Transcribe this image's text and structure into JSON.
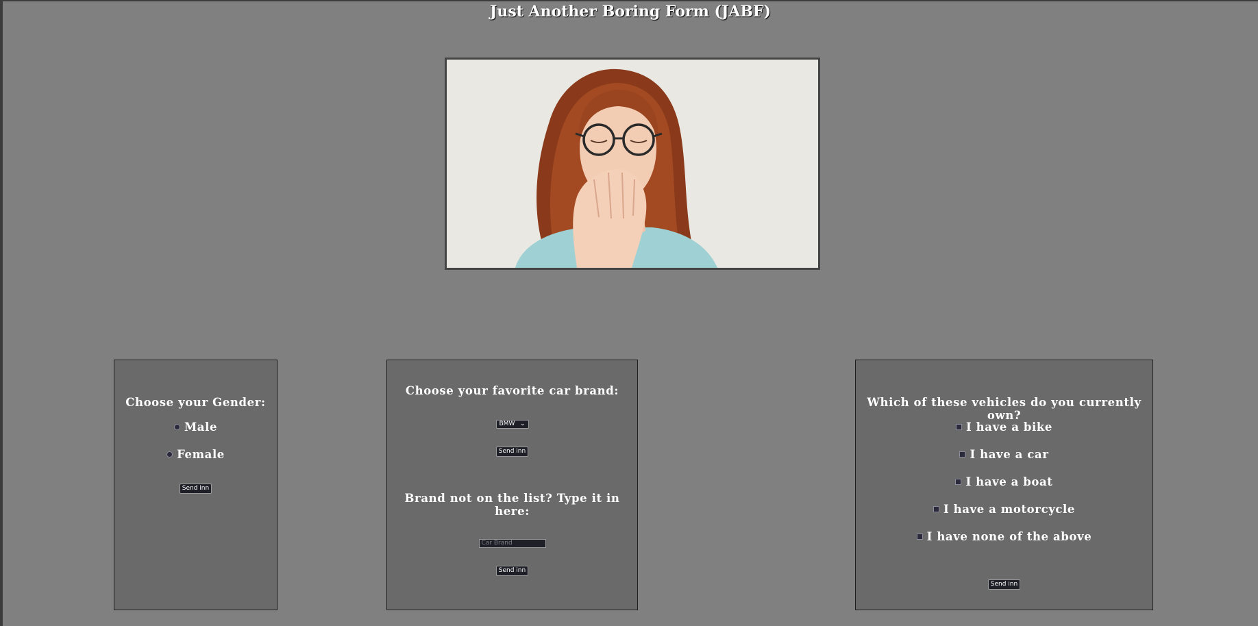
{
  "page": {
    "title": "Just Another Boring Form (JABF)"
  },
  "gender": {
    "heading": "Choose your Gender:",
    "options": [
      "Male",
      "Female"
    ],
    "submit": "Send inn"
  },
  "car": {
    "heading": "Choose your favorite car brand:",
    "selected_brand": "BMW",
    "submit": "Send inn",
    "other_heading": "Brand not on the list? Type it in here:",
    "other_placeholder": "Car Brand",
    "other_submit": "Send inn"
  },
  "vehicles": {
    "heading": "Which of these vehicles do you currently own?",
    "options": [
      "I have a bike",
      "I have a car",
      "I have a boat",
      "I have a motorcycle",
      "I have none of the above"
    ],
    "submit": "Send inn"
  }
}
